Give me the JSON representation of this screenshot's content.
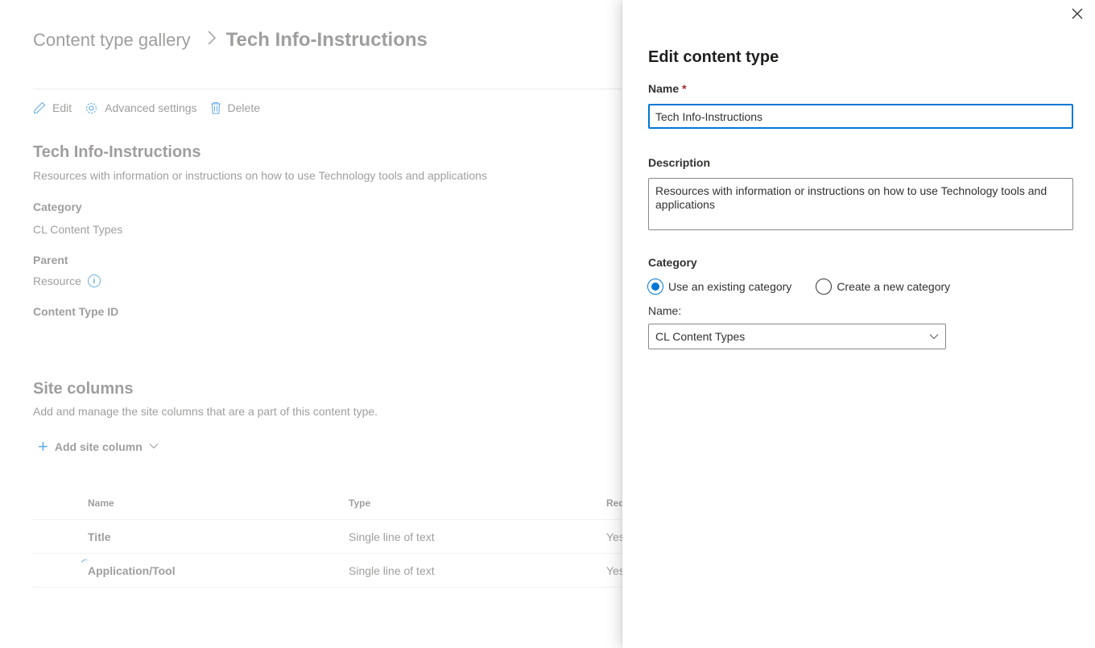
{
  "breadcrumb": {
    "parent": "Content type gallery",
    "separator": ">",
    "current": "Tech Info-Instructions"
  },
  "command_bar": {
    "edit": "Edit",
    "advanced": "Advanced settings",
    "delete": "Delete"
  },
  "content_type": {
    "title": "Tech Info-Instructions",
    "description": "Resources with information or instructions on how to use Technology tools and applications",
    "category_label": "Category",
    "category_value": "CL Content Types",
    "parent_label": "Parent",
    "parent_value": "Resource",
    "id_label": "Content Type ID"
  },
  "site_columns": {
    "title": "Site columns",
    "description": "Add and manage the site columns that are a part of this content type.",
    "add_label": "Add site column",
    "headers": {
      "name": "Name",
      "type": "Type",
      "required": "Req"
    },
    "rows": [
      {
        "name": "Title",
        "type": "Single line of text",
        "required": "Yes"
      },
      {
        "name": "Application/Tool",
        "type": "Single line of text",
        "required": "Yes"
      }
    ]
  },
  "panel": {
    "title": "Edit content type",
    "name_label": "Name",
    "required_marker": "*",
    "name_value": "Tech Info-Instructions",
    "description_label": "Description",
    "description_value": "Resources with information or instructions on how to use Technology tools and applications",
    "category_label": "Category",
    "radio_existing": "Use an existing category",
    "radio_new": "Create a new category",
    "selected_radio": "existing",
    "category_name_label": "Name:",
    "category_selected": "CL Content Types"
  },
  "colors": {
    "accent": "#0078d4",
    "required": "#a4262c"
  }
}
